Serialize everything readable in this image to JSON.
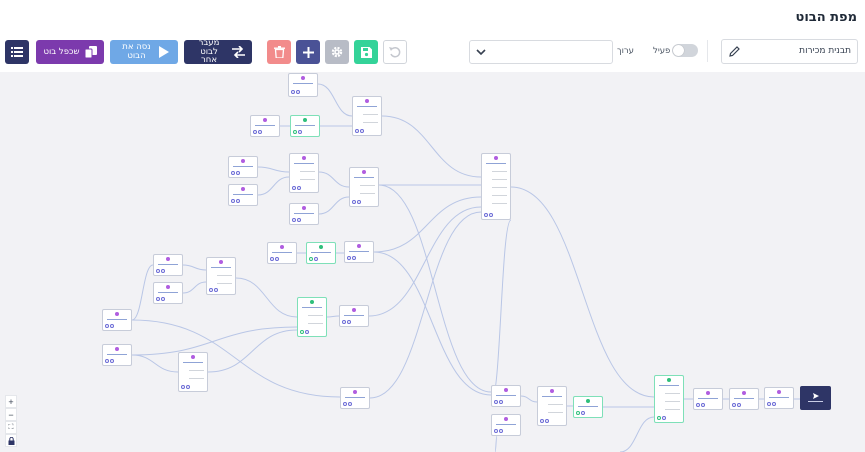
{
  "header": {
    "title": "מפת הבוט"
  },
  "toolbar": {
    "menu_button": {
      "icon": "menu-icon",
      "color": "#2e3566"
    },
    "clone_button": {
      "label": "שכפל בוט",
      "icon": "copy-icon",
      "color": "#7c3aad"
    },
    "test_button": {
      "label": "נסה את הבוט",
      "icon": "play-icon",
      "color": "#6fa8e6"
    },
    "switch_button": {
      "label": "מעבר לבוט אחר",
      "icon": "swap-icon",
      "color": "#2e3566"
    },
    "delete_button": {
      "icon": "trash-icon",
      "color": "#f28b8b"
    },
    "add_button": {
      "icon": "plus-icon",
      "color": "#4a5296"
    },
    "settings_button": {
      "icon": "gear-icon",
      "color": "#b8bcc6"
    },
    "save_button": {
      "icon": "save-icon",
      "color": "#34d399"
    },
    "undo_button": {
      "icon": "undo-icon",
      "color": "#d1d5db"
    },
    "select_value": "",
    "edit_label": "ערוך",
    "active_label": "פעיל",
    "active_toggle": false,
    "bot_name": "תבנית מכירות",
    "bot_name_icon": "pencil-icon"
  },
  "canvas": {
    "zoom_controls": [
      "+",
      "−",
      "⛶",
      "🔒"
    ],
    "send_node_icon": "send-icon"
  }
}
